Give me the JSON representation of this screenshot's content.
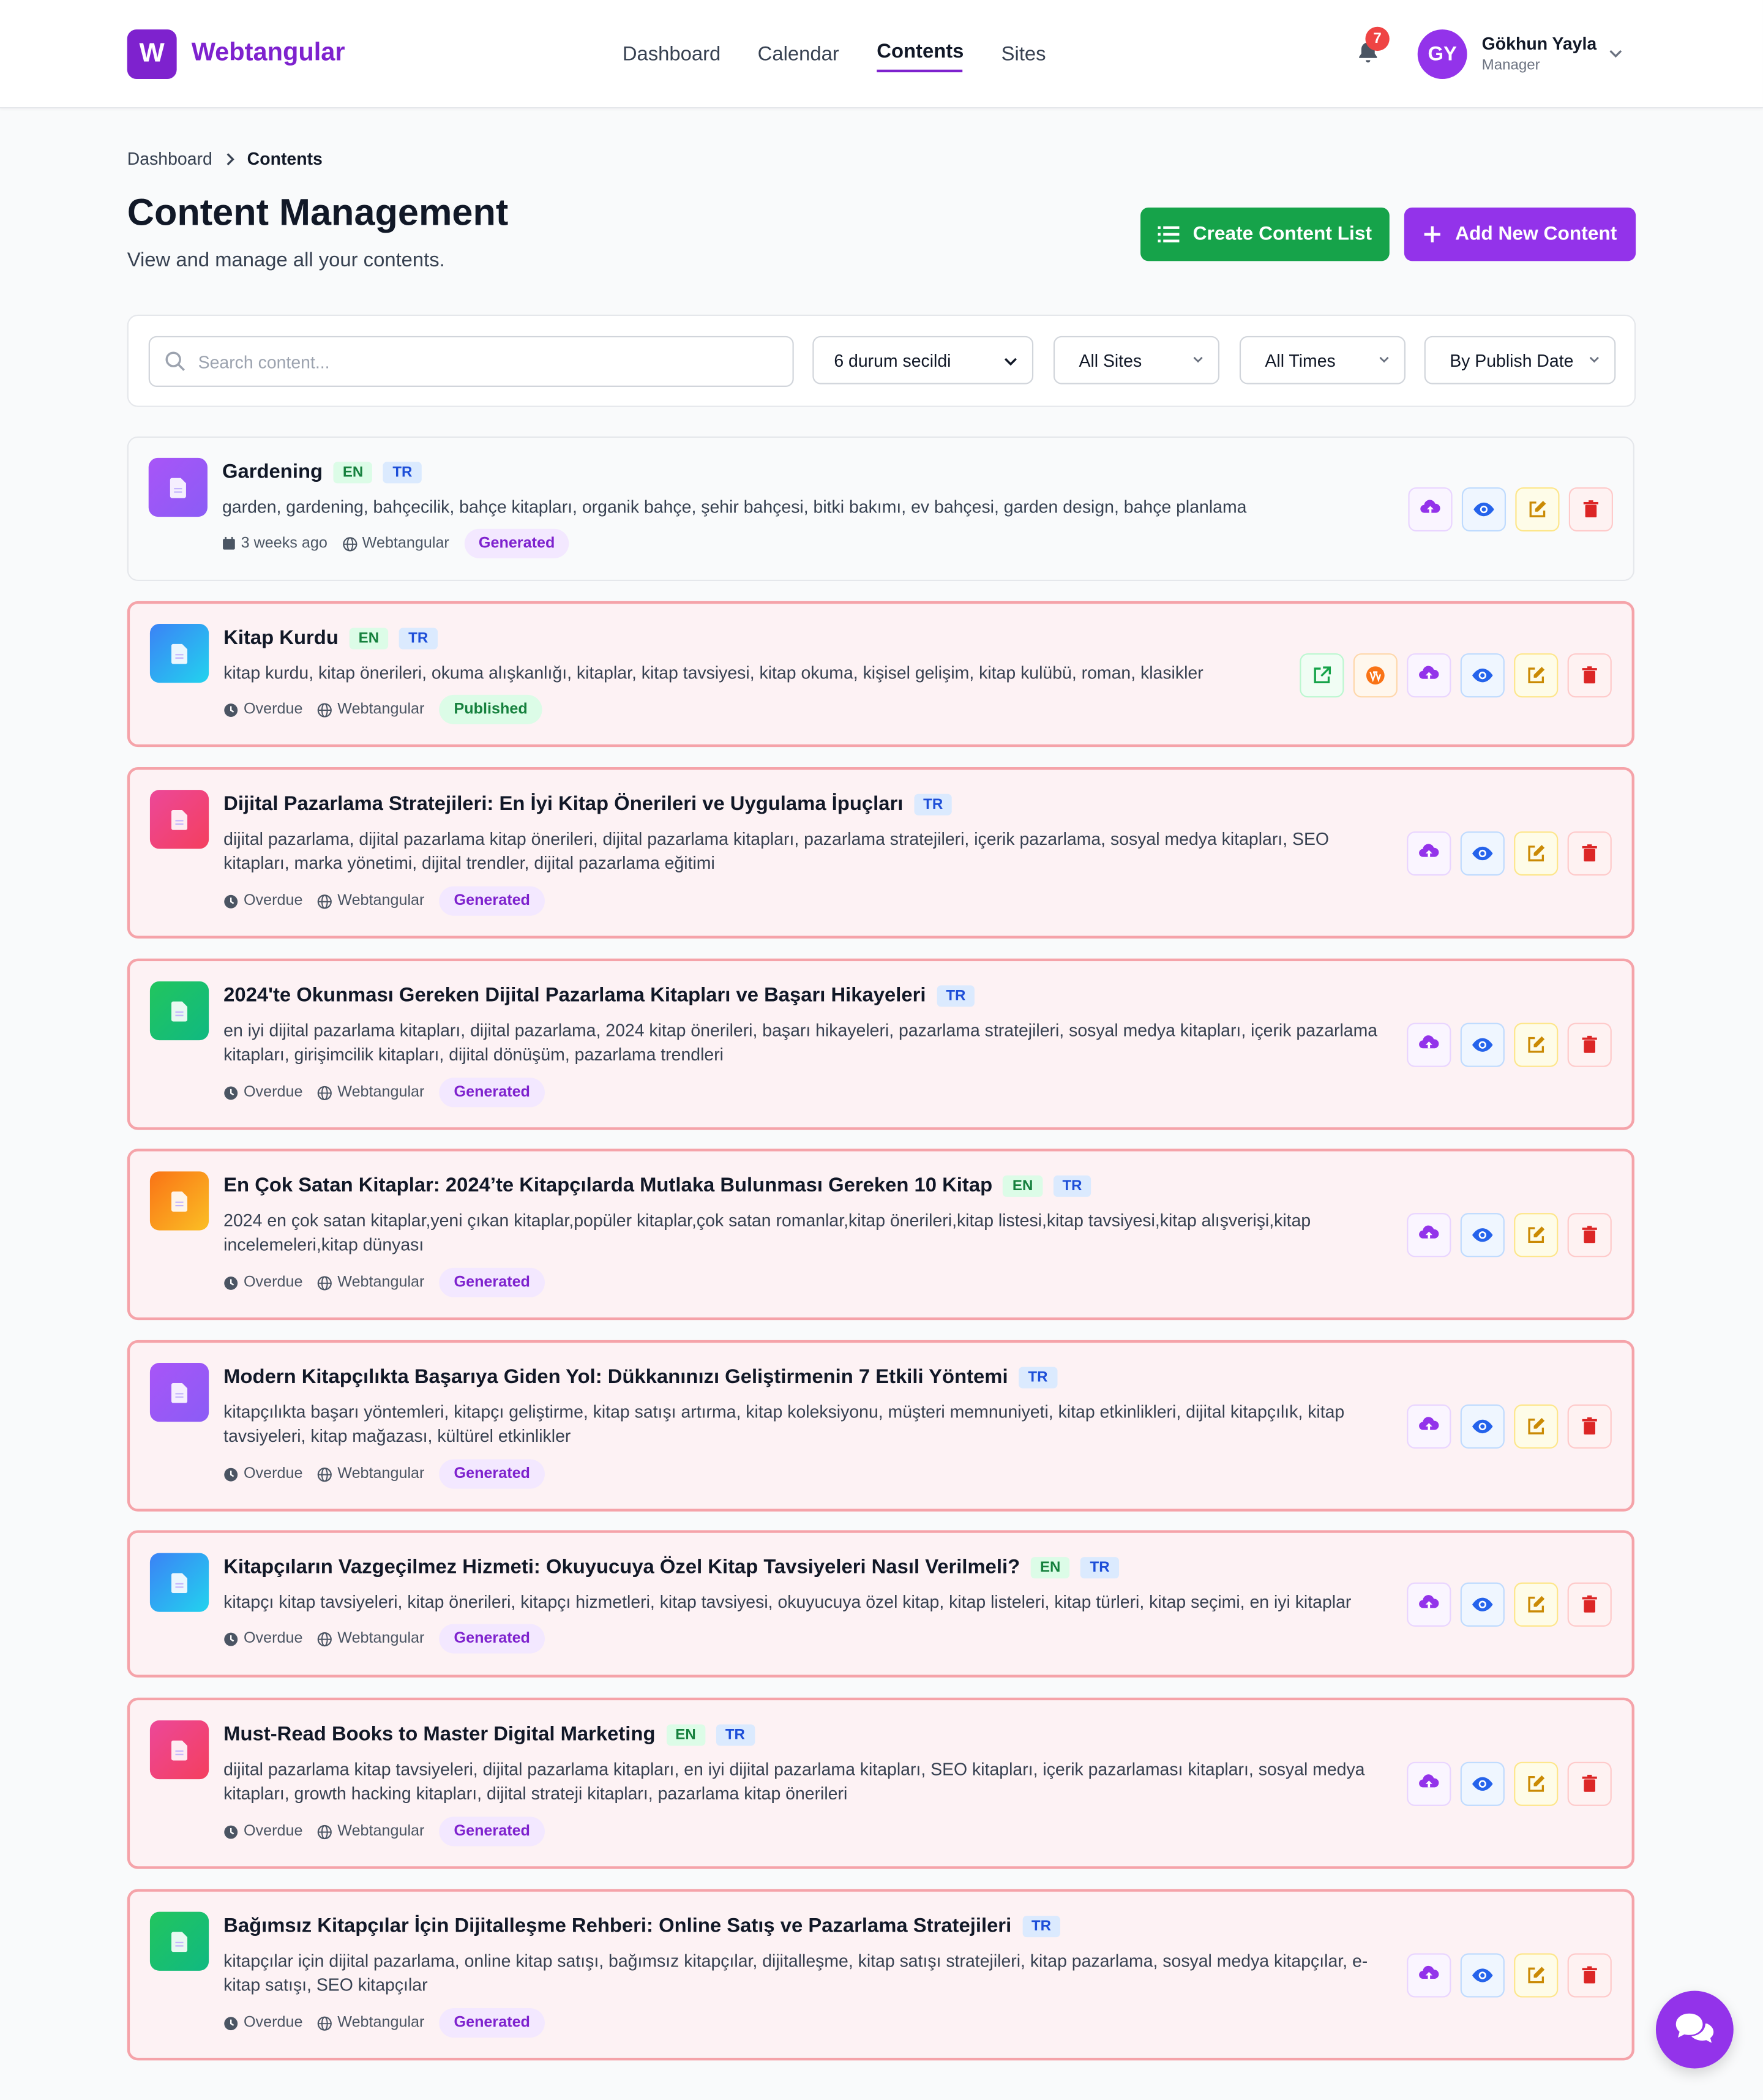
{
  "brand": {
    "logo_letter": "W",
    "name": "Webtangular",
    "color": "#7e22ce"
  },
  "nav": {
    "items": [
      "Dashboard",
      "Calendar",
      "Contents",
      "Sites"
    ],
    "active": "Contents"
  },
  "notifications": {
    "count": "7"
  },
  "user": {
    "initials": "GY",
    "name": "Gökhun Yayla",
    "role": "Manager"
  },
  "breadcrumb": {
    "root": "Dashboard",
    "current": "Contents"
  },
  "page": {
    "title": "Content Management",
    "subtitle": "View and manage all your contents."
  },
  "buttons": {
    "create_list": "Create Content List",
    "add_new": "Add New Content"
  },
  "filters": {
    "search_placeholder": "Search content...",
    "search_value": "",
    "status": "6 durum secildi",
    "sites": "All Sites",
    "times": "All Times",
    "sort": "By Publish Date"
  },
  "colors": {
    "green": "#16a34a",
    "purple": "#9333ea",
    "overdue_border": "#f5a3a9",
    "overdue_bg": "#fdf2f4"
  },
  "contents": [
    {
      "title": "Gardening",
      "langs": [
        "EN",
        "TR"
      ],
      "tags": "garden, gardening, bahçecilik, bahçe kitapları, organik bahçe, şehir bahçesi, bitki bakımı, ev bahçesi, garden design, bahçe planlama",
      "time": "3 weeks ago",
      "time_icon": "calendar-icon",
      "site": "Webtangular",
      "status": "Generated",
      "overdue": false,
      "icon_color": "purple",
      "actions": [
        "upload",
        "view",
        "edit",
        "delete"
      ]
    },
    {
      "title": "Kitap Kurdu",
      "langs": [
        "EN",
        "TR"
      ],
      "tags": "kitap kurdu, kitap önerileri, okuma alışkanlığı, kitaplar, kitap tavsiyesi, kitap okuma, kişisel gelişim, kitap kulübü, roman, klasikler",
      "time": "Overdue",
      "time_icon": "clock-icon",
      "site": "Webtangular",
      "status": "Published",
      "overdue": true,
      "icon_color": "blue",
      "actions": [
        "external",
        "wordpress",
        "upload",
        "view",
        "edit",
        "delete"
      ]
    },
    {
      "title": "Dijital Pazarlama Stratejileri: En İyi Kitap Önerileri ve Uygulama İpuçları",
      "langs": [
        "TR"
      ],
      "tags": "dijital pazarlama, dijital pazarlama kitap önerileri, dijital pazarlama kitapları, pazarlama stratejileri, içerik pazarlama, sosyal medya kitapları, SEO kitapları, marka yönetimi, dijital trendler, dijital pazarlama eğitimi",
      "time": "Overdue",
      "time_icon": "clock-icon",
      "site": "Webtangular",
      "status": "Generated",
      "overdue": true,
      "icon_color": "pink",
      "actions": [
        "upload",
        "view",
        "edit",
        "delete"
      ]
    },
    {
      "title": "2024'te Okunması Gereken Dijital Pazarlama Kitapları ve Başarı Hikayeleri",
      "langs": [
        "TR"
      ],
      "tags": "en iyi dijital pazarlama kitapları, dijital pazarlama, 2024 kitap önerileri, başarı hikayeleri, pazarlama stratejileri, sosyal medya kitapları, içerik pazarlama kitapları, girişimcilik kitapları, dijital dönüşüm, pazarlama trendleri",
      "time": "Overdue",
      "time_icon": "clock-icon",
      "site": "Webtangular",
      "status": "Generated",
      "overdue": true,
      "icon_color": "green",
      "actions": [
        "upload",
        "view",
        "edit",
        "delete"
      ]
    },
    {
      "title": "En Çok Satan Kitaplar: 2024’te Kitapçılarda Mutlaka Bulunması Gereken 10 Kitap",
      "langs": [
        "EN",
        "TR"
      ],
      "tags": "2024 en çok satan kitaplar,yeni çıkan kitaplar,popüler kitaplar,çok satan romanlar,kitap önerileri,kitap listesi,kitap tavsiyesi,kitap alışverişi,kitap incelemeleri,kitap dünyası",
      "time": "Overdue",
      "time_icon": "clock-icon",
      "site": "Webtangular",
      "status": "Generated",
      "overdue": true,
      "icon_color": "orange",
      "actions": [
        "upload",
        "view",
        "edit",
        "delete"
      ]
    },
    {
      "title": "Modern Kitapçılıkta Başarıya Giden Yol: Dükkanınızı Geliştirmenin 7 Etkili Yöntemi",
      "langs": [
        "TR"
      ],
      "tags": "kitapçılıkta başarı yöntemleri, kitapçı geliştirme, kitap satışı artırma, kitap koleksiyonu, müşteri memnuniyeti, kitap etkinlikleri, dijital kitapçılık, kitap tavsiyeleri, kitap mağazası, kültürel etkinlikler",
      "time": "Overdue",
      "time_icon": "clock-icon",
      "site": "Webtangular",
      "status": "Generated",
      "overdue": true,
      "icon_color": "purple",
      "actions": [
        "upload",
        "view",
        "edit",
        "delete"
      ]
    },
    {
      "title": "Kitapçıların Vazgeçilmez Hizmeti: Okuyucuya Özel Kitap Tavsiyeleri Nasıl Verilmeli?",
      "langs": [
        "EN",
        "TR"
      ],
      "tags": "kitapçı kitap tavsiyeleri, kitap önerileri, kitapçı hizmetleri, kitap tavsiyesi, okuyucuya özel kitap, kitap listeleri, kitap türleri, kitap seçimi, en iyi kitaplar",
      "time": "Overdue",
      "time_icon": "clock-icon",
      "site": "Webtangular",
      "status": "Generated",
      "overdue": true,
      "icon_color": "blue",
      "actions": [
        "upload",
        "view",
        "edit",
        "delete"
      ]
    },
    {
      "title": "Must-Read Books to Master Digital Marketing",
      "langs": [
        "EN",
        "TR"
      ],
      "tags": "dijital pazarlama kitap tavsiyeleri, dijital pazarlama kitapları, en iyi dijital pazarlama kitapları, SEO kitapları, içerik pazarlaması kitapları, sosyal medya kitapları, growth hacking kitapları, dijital strateji kitapları, pazarlama kitap önerileri",
      "time": "Overdue",
      "time_icon": "clock-icon",
      "site": "Webtangular",
      "status": "Generated",
      "overdue": true,
      "icon_color": "pink",
      "actions": [
        "upload",
        "view",
        "edit",
        "delete"
      ]
    },
    {
      "title": "Bağımsız Kitapçılar İçin Dijitalleşme Rehberi: Online Satış ve Pazarlama Stratejileri",
      "langs": [
        "TR"
      ],
      "tags": "kitapçılar için dijital pazarlama, online kitap satışı, bağımsız kitapçılar, dijitalleşme, kitap satışı stratejileri, kitap pazarlama, sosyal medya kitapçılar, e-kitap satışı, SEO kitapçılar",
      "time": "Overdue",
      "time_icon": "clock-icon",
      "site": "Webtangular",
      "status": "Generated",
      "overdue": true,
      "icon_color": "green",
      "actions": [
        "upload",
        "view",
        "edit",
        "delete"
      ]
    }
  ]
}
